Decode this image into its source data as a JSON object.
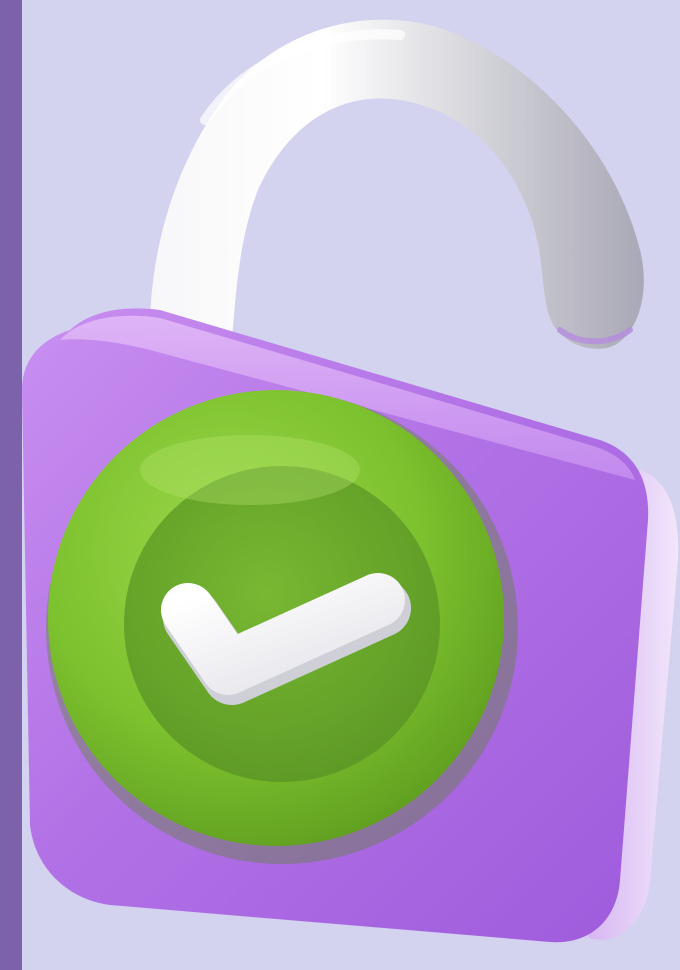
{
  "scene": {
    "subject": "unlocked-padlock-with-checkmark",
    "shackle_state": "open",
    "colors": {
      "background": "#d3d2ef",
      "side_bar": "#7c62aa",
      "lock_body": "#b06fe0",
      "badge_ring": "#7cc12e",
      "badge_center": "#67a82a",
      "checkmark": "#ffffff",
      "shackle": "#e6e6ea"
    }
  }
}
